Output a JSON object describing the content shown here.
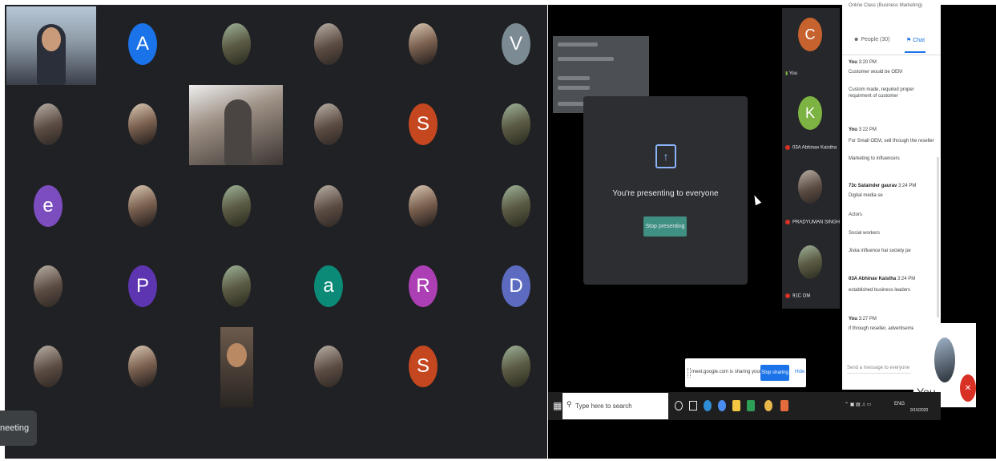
{
  "left_meeting": {
    "tiles": [
      {
        "kind": "photo"
      },
      {
        "kind": "letter",
        "letter": "A",
        "color": "#1a73e8"
      },
      {
        "kind": "photo"
      },
      {
        "kind": "photo"
      },
      {
        "kind": "photo"
      },
      {
        "kind": "letter",
        "letter": "V",
        "color": "#7b8a93"
      },
      {
        "kind": "photo"
      },
      {
        "kind": "photo"
      },
      {
        "kind": "video"
      },
      {
        "kind": "photo"
      },
      {
        "kind": "letter",
        "letter": "S",
        "color": "#c4471f"
      },
      {
        "kind": "photo"
      },
      {
        "kind": "letter",
        "letter": "e",
        "color": "#7c4dbe"
      },
      {
        "kind": "photo"
      },
      {
        "kind": "photo"
      },
      {
        "kind": "photo"
      },
      {
        "kind": "photo"
      },
      {
        "kind": "photo"
      },
      {
        "kind": "photo"
      },
      {
        "kind": "letter",
        "letter": "P",
        "color": "#5e35b1"
      },
      {
        "kind": "photo"
      },
      {
        "kind": "letter",
        "letter": "a",
        "color": "#0b8a78"
      },
      {
        "kind": "letter",
        "letter": "R",
        "color": "#ad3fb5"
      },
      {
        "kind": "letter",
        "letter": "D",
        "color": "#5c6bc0"
      },
      {
        "kind": "photo"
      },
      {
        "kind": "photo"
      },
      {
        "kind": "video"
      },
      {
        "kind": "photo"
      },
      {
        "kind": "letter",
        "letter": "S",
        "color": "#c4471f"
      },
      {
        "kind": "photo"
      }
    ],
    "meeting_chip_label": "neeting"
  },
  "presenting": {
    "message": "You're presenting to everyone",
    "stop_label": "Stop presenting"
  },
  "participants_strip": [
    {
      "letter": "C",
      "color": "#c5622d",
      "name": "You"
    },
    {
      "letter": "K",
      "color": "#7cb342",
      "name": "03A Abhinav Kaistha"
    },
    {
      "letter": "",
      "color": "",
      "name": "PRADYUMAN SINGH"
    },
    {
      "letter": "",
      "color": "",
      "name": "91C OM"
    }
  ],
  "chat": {
    "header_text": "Online Class (Business Marketing)",
    "people_tab": "People (30)",
    "chat_tab": "Chat",
    "messages": [
      {
        "sender": "You",
        "time": "3:20 PM",
        "lines": [
          "Customer would be OEM",
          "Custom made, required proper requirment of customer"
        ]
      },
      {
        "sender": "You",
        "time": "3:22 PM",
        "lines": [
          "For Small OEM, sell through the reseller",
          "Marketing to influencers"
        ]
      },
      {
        "sender": "73c Satainder gaurav",
        "time": "3:24 PM",
        "lines": [
          "Digital media se",
          "Actors",
          "Social workers",
          "Jiska influence hai society pe"
        ]
      },
      {
        "sender": "03A Abhinav Kaistha",
        "time": "3:24 PM",
        "lines": [
          "established business leaders"
        ]
      },
      {
        "sender": "You",
        "time": "3:27 PM",
        "lines": [
          "if through reseller, advertisement is cru"
        ]
      }
    ],
    "input_placeholder": "Send a message to everyone"
  },
  "sharing_bar": {
    "text": "meet.google.com is sharing your screen.",
    "stop_label": "Stop sharing",
    "hide_label": "Hide"
  },
  "self_tile": {
    "label": "You"
  },
  "taskbar": {
    "search_placeholder": "Type here to search",
    "lang": "ENG",
    "date": "9/15/2020"
  },
  "colors": {
    "meet_dark": "#202124",
    "accent_blue": "#1a73e8",
    "present_teal": "#3f8f83",
    "mute_red": "#d93025"
  }
}
